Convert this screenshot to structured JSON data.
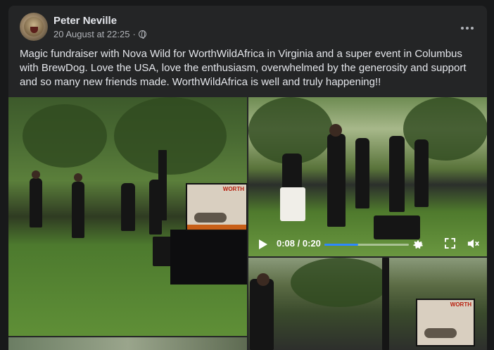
{
  "post": {
    "author": "Peter Neville",
    "timestamp": "20 August at 22:25",
    "separator": "·",
    "audience_icon": "globe-icon",
    "text": "Magic fundraiser with Nova Wild for WorthWildAfrica in Virginia and a super event in Columbus with BrewDog. Love the USA, love the enthusiasm, overwhelmed by the generosity and support and so many new friends made. WorthWildAfrica is well and truly happening!!",
    "more_icon": "more-options-icon"
  },
  "media": {
    "banner_logo": "WORTH",
    "video": {
      "time_display": "0:08 / 0:20",
      "progress": 0.4,
      "play_icon": "play-icon",
      "settings_icon": "gear-icon",
      "fullscreen_icon": "expand-icon",
      "volume_icon": "volume-icon"
    }
  },
  "colors": {
    "background": "#18191a",
    "card": "#242526",
    "text_primary": "#e4e6eb",
    "text_secondary": "#b0b3b8",
    "progress_accent": "#2d88ff"
  }
}
